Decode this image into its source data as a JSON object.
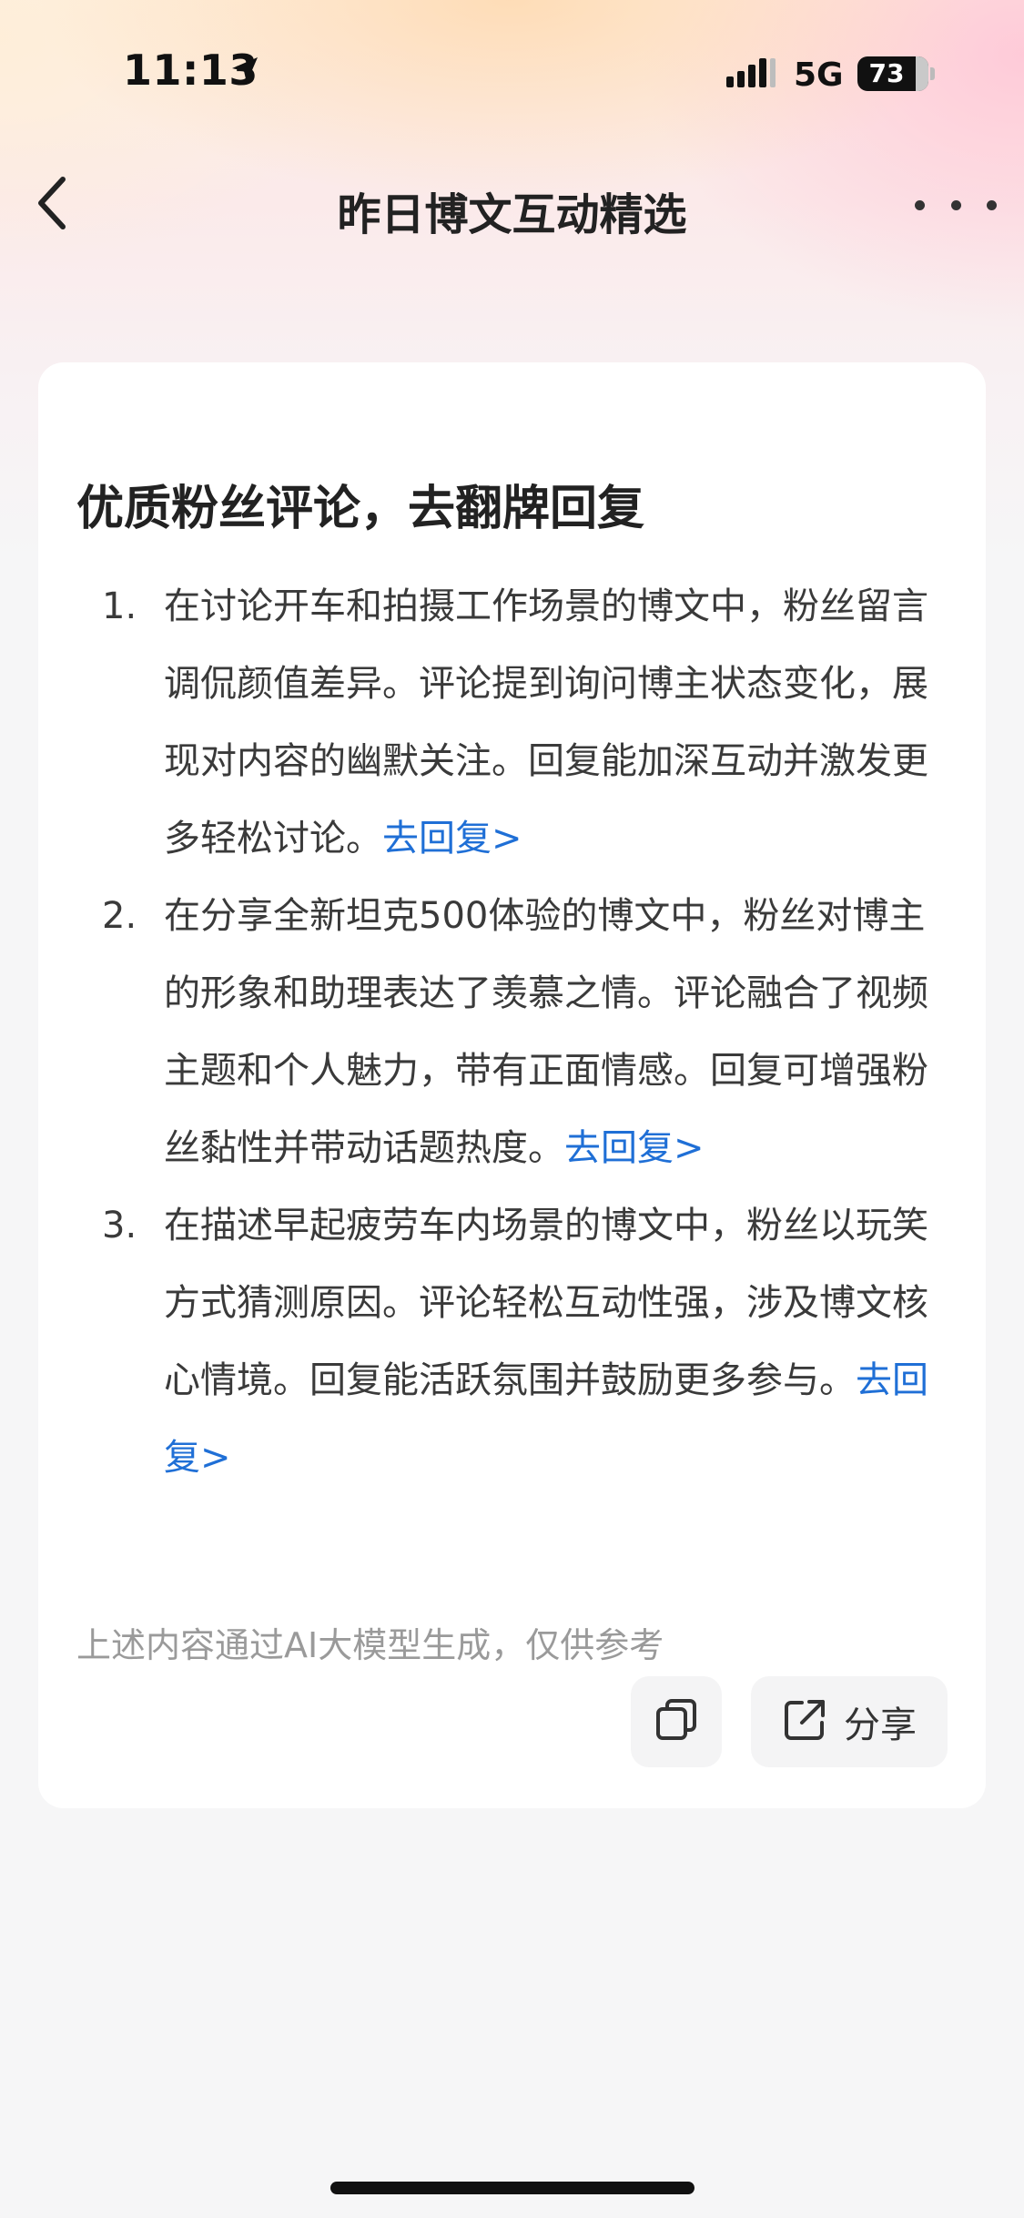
{
  "status_bar": {
    "time": "11:13",
    "network": "5G",
    "battery": "73",
    "icons": [
      "location-arrow-icon",
      "signal-icon",
      "battery-icon"
    ]
  },
  "nav": {
    "title": "昨日博文互动精选",
    "back_icon": "chevron-left-icon",
    "more_icon": "more-dots-icon"
  },
  "card": {
    "title": "优质粉丝评论，去翻牌回复",
    "items": [
      {
        "number": "1.",
        "text": "在讨论开车和拍摄工作场景的博文中，粉丝留言调侃颜值差异。评论提到询问博主状态变化，展现对内容的幽默关注。回复能加深互动并激发更多轻松讨论。",
        "link": "去回复>"
      },
      {
        "number": "2.",
        "text": "在分享全新坦克500体验的博文中，粉丝对博主的形象和助理表达了羡慕之情。评论融合了视频主题和个人魅力，带有正面情感。回复可增强粉丝黏性并带动话题热度。",
        "link": "去回复>"
      },
      {
        "number": "3.",
        "text": "在描述早起疲劳车内场景的博文中，粉丝以玩笑方式猜测原因。评论轻松互动性强，涉及博文核心情境。回复能活跃氛围并鼓励更多参与。",
        "link": "去回复>"
      }
    ],
    "disclaimer": "上述内容通过AI大模型生成，仅供参考",
    "actions": {
      "copy_icon": "copy-icon",
      "share_icon": "share-icon",
      "share_label": "分享"
    }
  },
  "colors": {
    "link": "#1f6fd6",
    "card_bg": "#ffffff",
    "page_bg": "#f6f6f7"
  }
}
